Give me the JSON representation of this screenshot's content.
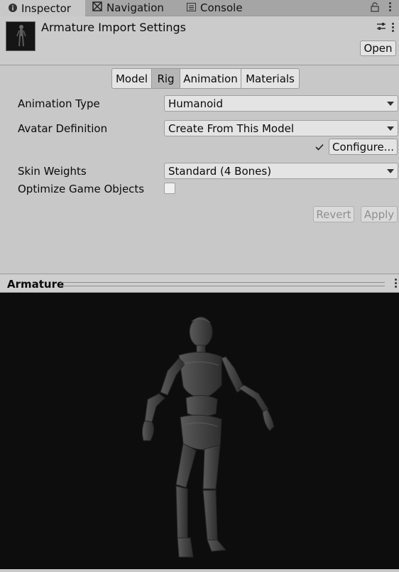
{
  "tabs": [
    {
      "label": "Inspector",
      "icon": "info-icon",
      "active": true
    },
    {
      "label": "Navigation",
      "icon": "navigation-icon",
      "active": false
    },
    {
      "label": "Console",
      "icon": "console-icon",
      "active": false
    }
  ],
  "header": {
    "title": "Armature Import Settings",
    "open_label": "Open"
  },
  "section_tabs": [
    {
      "label": "Model",
      "active": false
    },
    {
      "label": "Rig",
      "active": true
    },
    {
      "label": "Animation",
      "active": false
    },
    {
      "label": "Materials",
      "active": false
    }
  ],
  "rig": {
    "animation_type": {
      "label": "Animation Type",
      "value": "Humanoid"
    },
    "avatar_definition": {
      "label": "Avatar Definition",
      "value": "Create From This Model"
    },
    "configure_label": "Configure...",
    "skin_weights": {
      "label": "Skin Weights",
      "value": "Standard (4 Bones)"
    },
    "optimize_game_objects": {
      "label": "Optimize Game Objects",
      "checked": false
    }
  },
  "actions": {
    "revert_label": "Revert",
    "apply_label": "Apply"
  },
  "preview": {
    "title": "Armature"
  },
  "colors": {
    "panel": "#c8c8c8",
    "tabbar": "#a5a5a5",
    "viewport": "#0d0d0d",
    "model": "#4a4a4a"
  }
}
